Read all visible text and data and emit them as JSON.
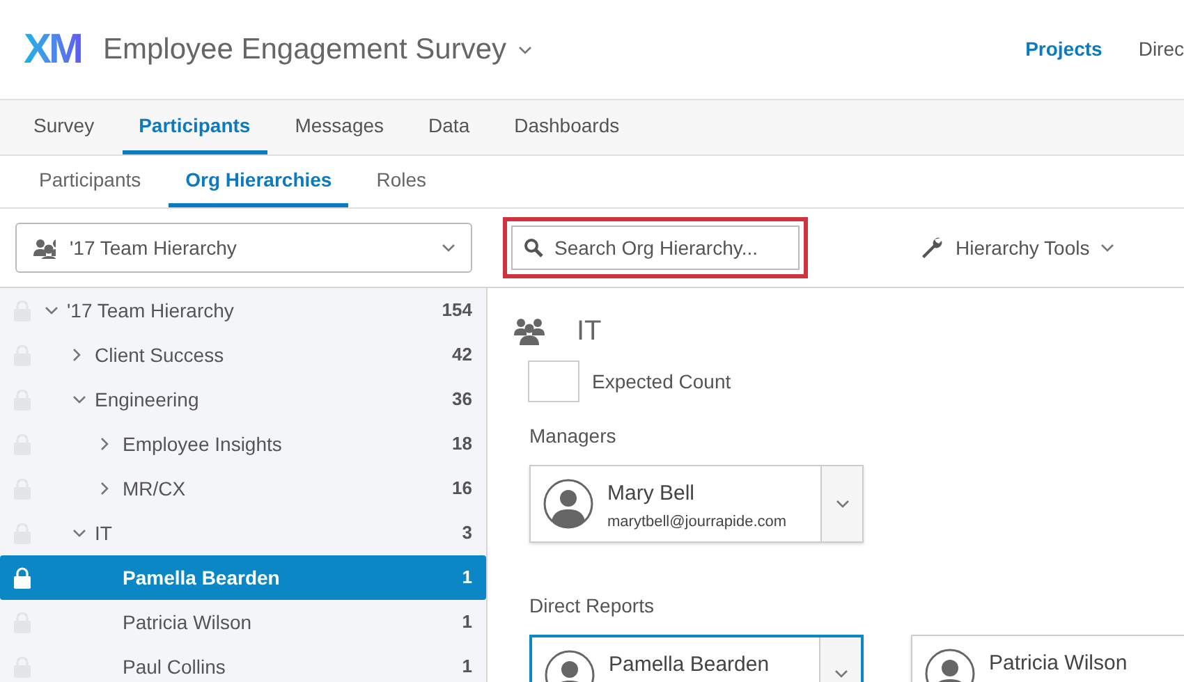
{
  "header": {
    "logo": "XM",
    "title": "Employee Engagement Survey",
    "links": [
      {
        "label": "Projects",
        "selected": true
      },
      {
        "label": "Direc",
        "selected": false
      }
    ]
  },
  "tabs": [
    {
      "label": "Survey",
      "selected": false
    },
    {
      "label": "Participants",
      "selected": true
    },
    {
      "label": "Messages",
      "selected": false
    },
    {
      "label": "Data",
      "selected": false
    },
    {
      "label": "Dashboards",
      "selected": false
    }
  ],
  "subtabs": [
    {
      "label": "Participants",
      "selected": false
    },
    {
      "label": "Org Hierarchies",
      "selected": true
    },
    {
      "label": "Roles",
      "selected": false
    }
  ],
  "toolbar": {
    "hierarchy_select": "'17 Team Hierarchy",
    "search": {
      "placeholder": "Search Org Hierarchy...",
      "highlighted": true
    },
    "tools_button": "Hierarchy Tools"
  },
  "tree": [
    {
      "label": "'17 Team Hierarchy",
      "count": "154",
      "expanded": true,
      "selected": false,
      "children": [
        {
          "label": "Client Success",
          "count": "42",
          "expanded": false,
          "selected": false
        },
        {
          "label": "Engineering",
          "count": "36",
          "expanded": true,
          "selected": false,
          "children": [
            {
              "label": "Employee Insights",
              "count": "18",
              "expanded": false,
              "selected": false
            },
            {
              "label": "MR/CX",
              "count": "16",
              "expanded": false,
              "selected": false
            }
          ]
        },
        {
          "label": "IT",
          "count": "3",
          "expanded": true,
          "selected": false,
          "children": [
            {
              "label": "Pamella Bearden",
              "count": "1",
              "selected": true
            },
            {
              "label": "Patricia Wilson",
              "count": "1",
              "selected": false
            },
            {
              "label": "Paul Collins",
              "count": "1",
              "selected": false
            }
          ]
        }
      ]
    }
  ],
  "detail": {
    "title": "IT",
    "expected_count_label": "Expected Count",
    "managers_heading": "Managers",
    "managers": [
      {
        "name": "Mary Bell",
        "email": "marytbell@jourrapide.com",
        "selected": false
      }
    ],
    "direct_reports_heading": "Direct Reports",
    "direct_reports": [
      {
        "name": "Pamella Bearden",
        "selected": true,
        "has_menu": true
      },
      {
        "name": "Patricia Wilson",
        "selected": false
      }
    ]
  }
}
